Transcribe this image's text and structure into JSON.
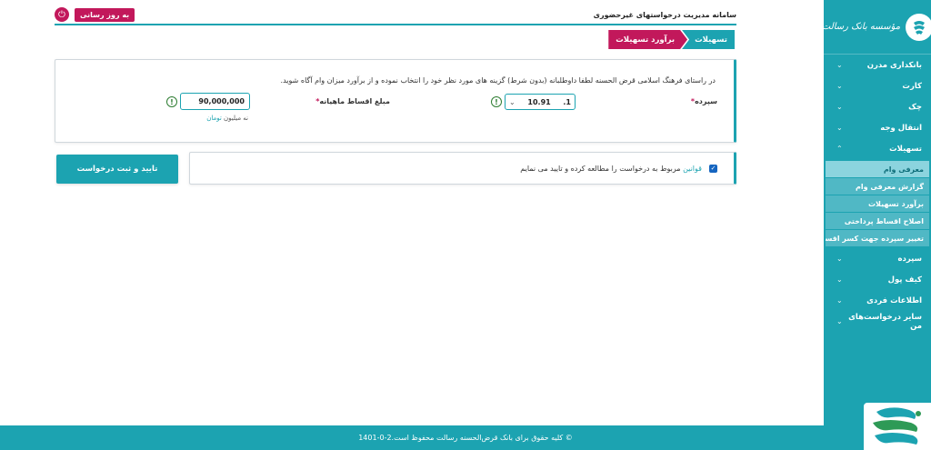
{
  "brand": {
    "logo_text": "مؤسسه بانک رسالت",
    "accent": "#1ca3b1",
    "secondary": "#c2185b"
  },
  "header": {
    "system_title": "سامانه مدیریت درخواستهای غیرحضوری",
    "refresh_label": "به روز رسانی"
  },
  "breadcrumb": {
    "items": [
      {
        "label": "تسهیلات"
      },
      {
        "label": "برآورد تسهیلات"
      }
    ]
  },
  "sidebar": {
    "items": [
      {
        "label": "بانکداری مدرن",
        "chevron": "⌄"
      },
      {
        "label": "کارت",
        "chevron": "⌄"
      },
      {
        "label": "چک",
        "chevron": "⌄"
      },
      {
        "label": "انتقال وجه",
        "chevron": "⌄"
      },
      {
        "label": "تسهیلات",
        "chevron": "⌃"
      },
      {
        "label": "سپرده",
        "chevron": "⌄"
      },
      {
        "label": "کیف پول",
        "chevron": "⌄"
      },
      {
        "label": "اطلاعات فردی",
        "chevron": "⌄"
      },
      {
        "label": "سایر درخواست‌های من",
        "chevron": "⌄"
      }
    ],
    "submenu": [
      {
        "label": "معرفی وام",
        "active": true
      },
      {
        "label": "گزارش معرفی وام"
      },
      {
        "label": "برآورد تسهیلات"
      },
      {
        "label": "اصلاح اقساط پرداختی"
      },
      {
        "label": "تغییر سپرده جهت کسر اقساط"
      }
    ]
  },
  "form": {
    "instruction": "در راستای فرهنگ اسلامی قرض الحسنه لطفا داوطلبانه (بدون شرط) گزینه های مورد نظر خود را انتخاب نموده و از برآورد میزان وام آگاه شوید.",
    "deposit_label": "سپرده",
    "required_mark": "*",
    "deposit_value": "10.91",
    "deposit_suffix": ".1",
    "dropdown_glyph": "⌄",
    "monthly_label": "مبلغ اقساط ماهیانه",
    "monthly_value": "90,000,000",
    "unit_prefix": "نه میلیون",
    "unit_accent": "تومان",
    "info_glyph": "!"
  },
  "terms": {
    "link_text": "قوانین",
    "text": " مربوط به درخواست را مطالعه کرده و تایید می نمایم",
    "checked": true,
    "check_glyph": "✓"
  },
  "actions": {
    "submit_label": "تایید و ثبت درخواست"
  },
  "footer": {
    "text": "© کلیه حقوق برای بانک قرض‌الحسنه رسالت محفوظ است.2-0-1401"
  }
}
